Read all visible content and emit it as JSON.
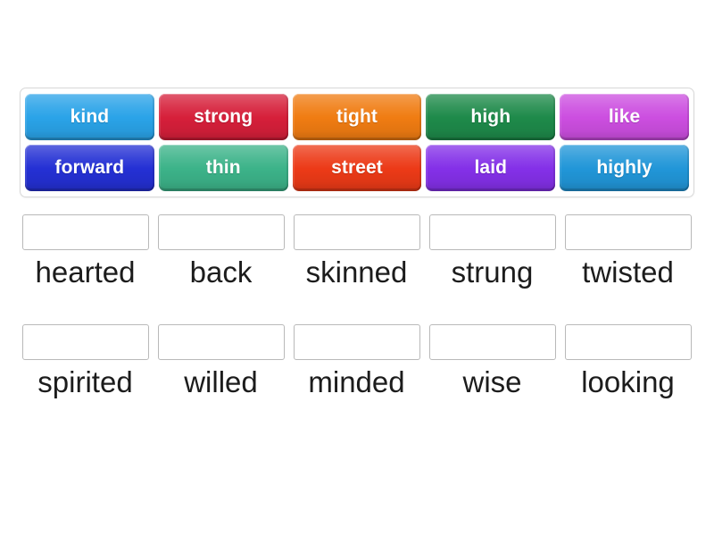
{
  "activity": {
    "type": "drag-and-drop-match",
    "background_color": "#ffffff"
  },
  "word_bank": {
    "border_color": "#d8d8d8",
    "rows": [
      [
        {
          "label": "kind",
          "color": "#2aa3e8"
        },
        {
          "label": "strong",
          "color": "#d61f3a"
        },
        {
          "label": "tight",
          "color": "#f07c12"
        },
        {
          "label": "high",
          "color": "#1e8a4a"
        },
        {
          "label": "like",
          "color": "#cc4ee0"
        }
      ],
      [
        {
          "label": "forward",
          "color": "#2430d4"
        },
        {
          "label": "thin",
          "color": "#3cb389"
        },
        {
          "label": "street",
          "color": "#ec3a17"
        },
        {
          "label": "laid",
          "color": "#8430e8"
        },
        {
          "label": "highly",
          "color": "#2196d8"
        }
      ]
    ]
  },
  "answers": {
    "box_border_color": "#b9b9b9",
    "rows": [
      [
        {
          "label": "hearted",
          "value": ""
        },
        {
          "label": "back",
          "value": ""
        },
        {
          "label": "skinned",
          "value": ""
        },
        {
          "label": "strung",
          "value": ""
        },
        {
          "label": "twisted",
          "value": ""
        }
      ],
      [
        {
          "label": "spirited",
          "value": ""
        },
        {
          "label": "willed",
          "value": ""
        },
        {
          "label": "minded",
          "value": ""
        },
        {
          "label": "wise",
          "value": ""
        },
        {
          "label": "looking",
          "value": ""
        }
      ]
    ]
  }
}
